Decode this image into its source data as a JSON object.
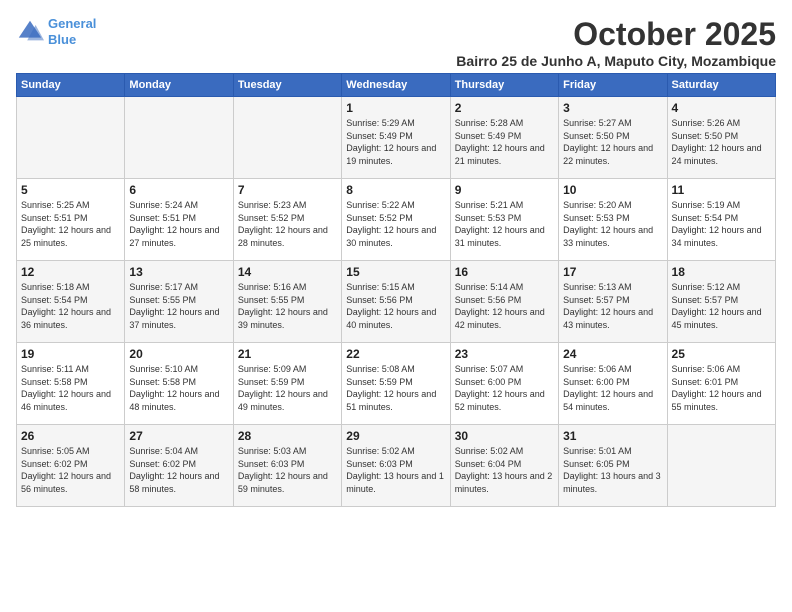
{
  "logo": {
    "line1": "General",
    "line2": "Blue"
  },
  "title": "October 2025",
  "subtitle": "Bairro 25 de Junho A, Maputo City, Mozambique",
  "weekdays": [
    "Sunday",
    "Monday",
    "Tuesday",
    "Wednesday",
    "Thursday",
    "Friday",
    "Saturday"
  ],
  "weeks": [
    [
      {
        "day": "",
        "sunrise": "",
        "sunset": "",
        "daylight": ""
      },
      {
        "day": "",
        "sunrise": "",
        "sunset": "",
        "daylight": ""
      },
      {
        "day": "",
        "sunrise": "",
        "sunset": "",
        "daylight": ""
      },
      {
        "day": "1",
        "sunrise": "Sunrise: 5:29 AM",
        "sunset": "Sunset: 5:49 PM",
        "daylight": "Daylight: 12 hours and 19 minutes."
      },
      {
        "day": "2",
        "sunrise": "Sunrise: 5:28 AM",
        "sunset": "Sunset: 5:49 PM",
        "daylight": "Daylight: 12 hours and 21 minutes."
      },
      {
        "day": "3",
        "sunrise": "Sunrise: 5:27 AM",
        "sunset": "Sunset: 5:50 PM",
        "daylight": "Daylight: 12 hours and 22 minutes."
      },
      {
        "day": "4",
        "sunrise": "Sunrise: 5:26 AM",
        "sunset": "Sunset: 5:50 PM",
        "daylight": "Daylight: 12 hours and 24 minutes."
      }
    ],
    [
      {
        "day": "5",
        "sunrise": "Sunrise: 5:25 AM",
        "sunset": "Sunset: 5:51 PM",
        "daylight": "Daylight: 12 hours and 25 minutes."
      },
      {
        "day": "6",
        "sunrise": "Sunrise: 5:24 AM",
        "sunset": "Sunset: 5:51 PM",
        "daylight": "Daylight: 12 hours and 27 minutes."
      },
      {
        "day": "7",
        "sunrise": "Sunrise: 5:23 AM",
        "sunset": "Sunset: 5:52 PM",
        "daylight": "Daylight: 12 hours and 28 minutes."
      },
      {
        "day": "8",
        "sunrise": "Sunrise: 5:22 AM",
        "sunset": "Sunset: 5:52 PM",
        "daylight": "Daylight: 12 hours and 30 minutes."
      },
      {
        "day": "9",
        "sunrise": "Sunrise: 5:21 AM",
        "sunset": "Sunset: 5:53 PM",
        "daylight": "Daylight: 12 hours and 31 minutes."
      },
      {
        "day": "10",
        "sunrise": "Sunrise: 5:20 AM",
        "sunset": "Sunset: 5:53 PM",
        "daylight": "Daylight: 12 hours and 33 minutes."
      },
      {
        "day": "11",
        "sunrise": "Sunrise: 5:19 AM",
        "sunset": "Sunset: 5:54 PM",
        "daylight": "Daylight: 12 hours and 34 minutes."
      }
    ],
    [
      {
        "day": "12",
        "sunrise": "Sunrise: 5:18 AM",
        "sunset": "Sunset: 5:54 PM",
        "daylight": "Daylight: 12 hours and 36 minutes."
      },
      {
        "day": "13",
        "sunrise": "Sunrise: 5:17 AM",
        "sunset": "Sunset: 5:55 PM",
        "daylight": "Daylight: 12 hours and 37 minutes."
      },
      {
        "day": "14",
        "sunrise": "Sunrise: 5:16 AM",
        "sunset": "Sunset: 5:55 PM",
        "daylight": "Daylight: 12 hours and 39 minutes."
      },
      {
        "day": "15",
        "sunrise": "Sunrise: 5:15 AM",
        "sunset": "Sunset: 5:56 PM",
        "daylight": "Daylight: 12 hours and 40 minutes."
      },
      {
        "day": "16",
        "sunrise": "Sunrise: 5:14 AM",
        "sunset": "Sunset: 5:56 PM",
        "daylight": "Daylight: 12 hours and 42 minutes."
      },
      {
        "day": "17",
        "sunrise": "Sunrise: 5:13 AM",
        "sunset": "Sunset: 5:57 PM",
        "daylight": "Daylight: 12 hours and 43 minutes."
      },
      {
        "day": "18",
        "sunrise": "Sunrise: 5:12 AM",
        "sunset": "Sunset: 5:57 PM",
        "daylight": "Daylight: 12 hours and 45 minutes."
      }
    ],
    [
      {
        "day": "19",
        "sunrise": "Sunrise: 5:11 AM",
        "sunset": "Sunset: 5:58 PM",
        "daylight": "Daylight: 12 hours and 46 minutes."
      },
      {
        "day": "20",
        "sunrise": "Sunrise: 5:10 AM",
        "sunset": "Sunset: 5:58 PM",
        "daylight": "Daylight: 12 hours and 48 minutes."
      },
      {
        "day": "21",
        "sunrise": "Sunrise: 5:09 AM",
        "sunset": "Sunset: 5:59 PM",
        "daylight": "Daylight: 12 hours and 49 minutes."
      },
      {
        "day": "22",
        "sunrise": "Sunrise: 5:08 AM",
        "sunset": "Sunset: 5:59 PM",
        "daylight": "Daylight: 12 hours and 51 minutes."
      },
      {
        "day": "23",
        "sunrise": "Sunrise: 5:07 AM",
        "sunset": "Sunset: 6:00 PM",
        "daylight": "Daylight: 12 hours and 52 minutes."
      },
      {
        "day": "24",
        "sunrise": "Sunrise: 5:06 AM",
        "sunset": "Sunset: 6:00 PM",
        "daylight": "Daylight: 12 hours and 54 minutes."
      },
      {
        "day": "25",
        "sunrise": "Sunrise: 5:06 AM",
        "sunset": "Sunset: 6:01 PM",
        "daylight": "Daylight: 12 hours and 55 minutes."
      }
    ],
    [
      {
        "day": "26",
        "sunrise": "Sunrise: 5:05 AM",
        "sunset": "Sunset: 6:02 PM",
        "daylight": "Daylight: 12 hours and 56 minutes."
      },
      {
        "day": "27",
        "sunrise": "Sunrise: 5:04 AM",
        "sunset": "Sunset: 6:02 PM",
        "daylight": "Daylight: 12 hours and 58 minutes."
      },
      {
        "day": "28",
        "sunrise": "Sunrise: 5:03 AM",
        "sunset": "Sunset: 6:03 PM",
        "daylight": "Daylight: 12 hours and 59 minutes."
      },
      {
        "day": "29",
        "sunrise": "Sunrise: 5:02 AM",
        "sunset": "Sunset: 6:03 PM",
        "daylight": "Daylight: 13 hours and 1 minute."
      },
      {
        "day": "30",
        "sunrise": "Sunrise: 5:02 AM",
        "sunset": "Sunset: 6:04 PM",
        "daylight": "Daylight: 13 hours and 2 minutes."
      },
      {
        "day": "31",
        "sunrise": "Sunrise: 5:01 AM",
        "sunset": "Sunset: 6:05 PM",
        "daylight": "Daylight: 13 hours and 3 minutes."
      },
      {
        "day": "",
        "sunrise": "",
        "sunset": "",
        "daylight": ""
      }
    ]
  ]
}
